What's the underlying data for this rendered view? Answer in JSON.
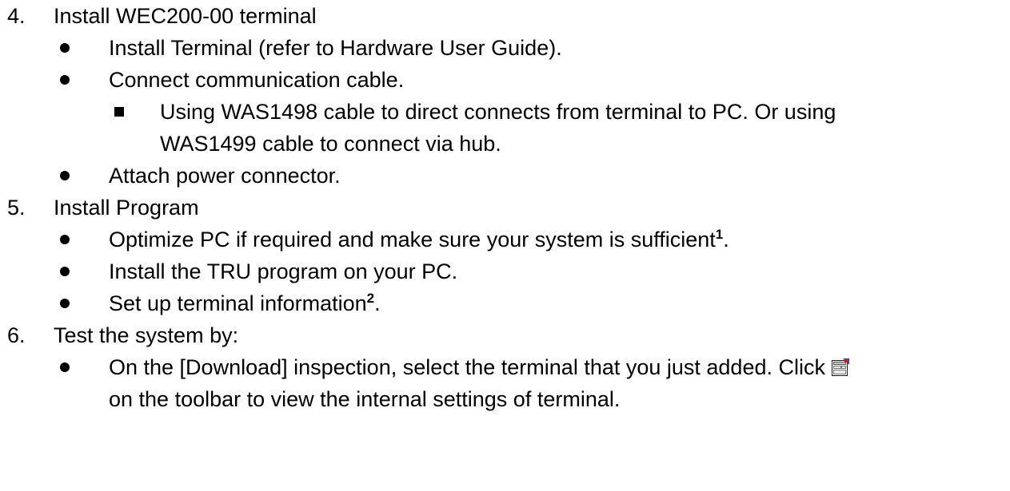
{
  "steps": [
    {
      "number": "4.",
      "title": "Install WEC200-00 terminal",
      "bullets": [
        {
          "text": "Install Terminal (refer to Hardware User Guide)."
        },
        {
          "text": "Connect communication cable.",
          "subitems": [
            {
              "line1": "Using WAS1498 cable to direct connects from terminal to PC. Or using",
              "line2": "WAS1499 cable to connect via hub."
            }
          ]
        },
        {
          "text": "Attach power connector."
        }
      ]
    },
    {
      "number": "5.",
      "title": "Install Program",
      "bullets": [
        {
          "text": "Optimize PC if required and make sure your system is sufficient",
          "footnote": "1",
          "after": "."
        },
        {
          "text": "Install the TRU program on your PC."
        },
        {
          "text": "Set up terminal information",
          "footnote": "2",
          "after": "."
        }
      ]
    },
    {
      "number": "6.",
      "title": "Test the system by:",
      "bullets": [
        {
          "line1": "On the [Download] inspection, select the terminal that you just added. Click",
          "icon": "terminal-properties-icon",
          "line2": "on the toolbar to view the internal settings of terminal."
        }
      ]
    }
  ]
}
